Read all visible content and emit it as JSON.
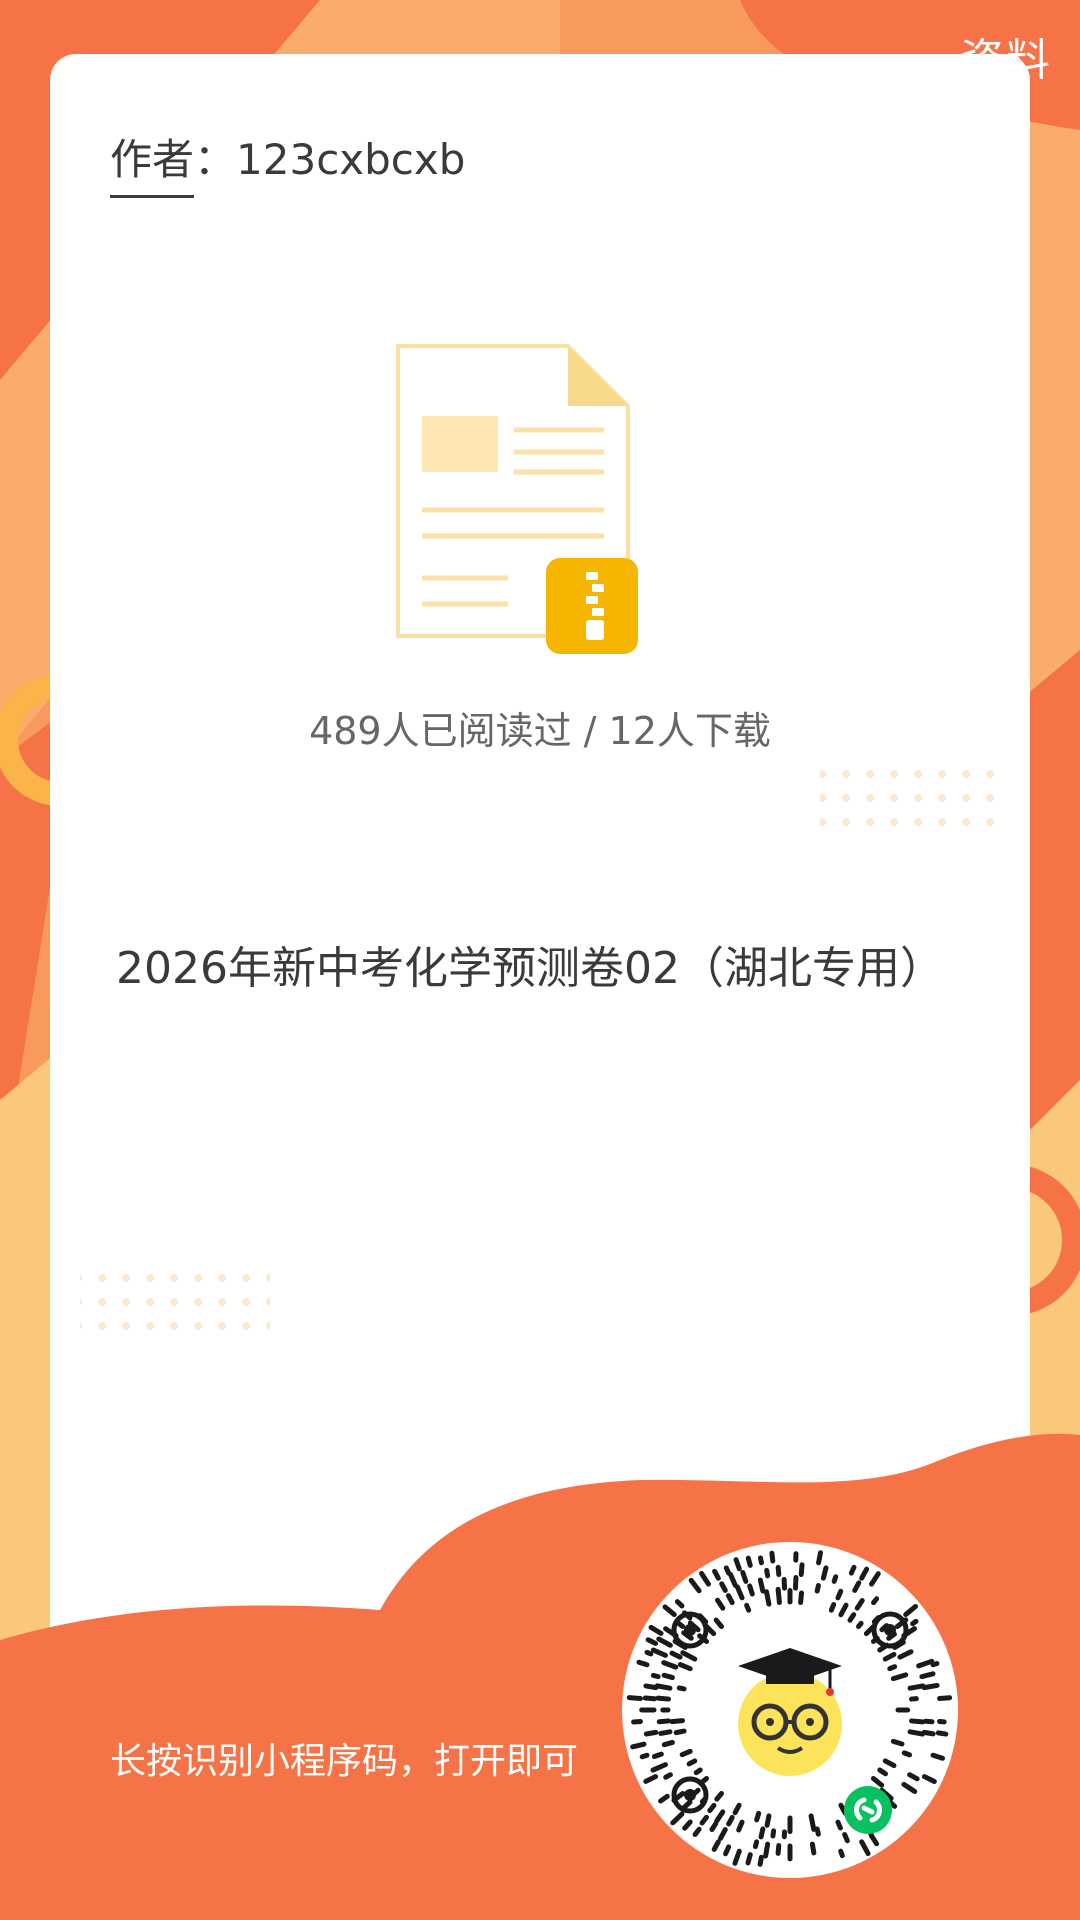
{
  "badge": {
    "label": "资料"
  },
  "author": {
    "label": "作者",
    "separator": "：",
    "name": "123cxbcxb"
  },
  "file": {
    "icon": "zip-document-icon"
  },
  "stats": {
    "text": "489人已阅读过 / 12人下载"
  },
  "document": {
    "title": "2026年新中考化学预测卷02（湖北专用）"
  },
  "footer": {
    "instruction": "长按识别小程序码，打开即可"
  },
  "qr": {
    "icon": "mini-program-code",
    "mascot": "graduate-mascot-icon",
    "badge_icon": "wechat-miniprogram-icon"
  },
  "colors": {
    "accent": "#f57347",
    "accent_light": "#fbc77a",
    "gold": "#f6b500",
    "text": "#3a3a3a",
    "muted": "#666666"
  }
}
